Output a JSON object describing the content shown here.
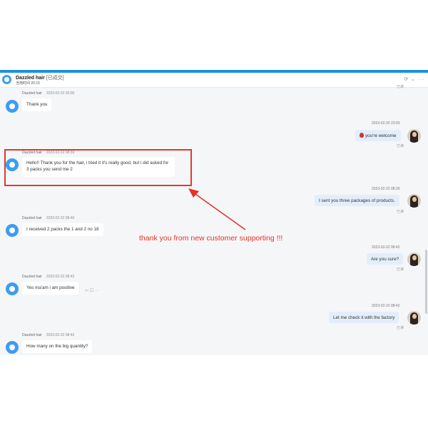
{
  "chat": {
    "contact_name": "Dazzled hair",
    "contact_tag": "[已成交]",
    "last_active": "当地时间 20:15",
    "header_icons": "⟳ ⌄ ···"
  },
  "messages": [
    {
      "side": "left",
      "sender": "Dazzled hair",
      "time": "2023-02-20 20:00",
      "text": "Thank you"
    },
    {
      "side": "right",
      "time": "2023-02-20 23:03",
      "text": "you're welcome",
      "status": "已读"
    },
    {
      "side": "left",
      "sender": "Dazzled hair",
      "time": "2023-02-22 08:39",
      "text": "Hello!! Thank you for the hair, i tried it it's really good, but i did asked for 3 packs you send me 2"
    },
    {
      "side": "right",
      "time": "2023-02-22 08:39",
      "text": "I sent you three packages of products.",
      "status": "已读"
    },
    {
      "side": "left",
      "sender": "Dazzled hair",
      "time": "2023-02-22 08:40",
      "text": "I received 2 packs the 1 and 2 no 18"
    },
    {
      "side": "right",
      "time": "2023-02-22 08:42",
      "text": "Are you sure?",
      "status": "已读"
    },
    {
      "side": "left",
      "sender": "Dazzled hair",
      "time": "2023-02-22 08:42",
      "text": "Yes ma'am i am positive"
    },
    {
      "side": "right",
      "time": "2023-02-22 08:42",
      "text": "Let me check it with the factory",
      "status": "已读"
    },
    {
      "side": "left",
      "sender": "Dazzled hair",
      "time": "2023-02-22 08:42",
      "text": "How many on the big quantity?"
    }
  ],
  "top_read_status": "已读",
  "reaction_icons": "⇦ ☐ ···",
  "annotation": "thank you from new customer supporting !!!",
  "colors": {
    "accent": "#1e8fe0",
    "highlight": "#e03a2f",
    "bubble_right": "#e3eefb"
  }
}
